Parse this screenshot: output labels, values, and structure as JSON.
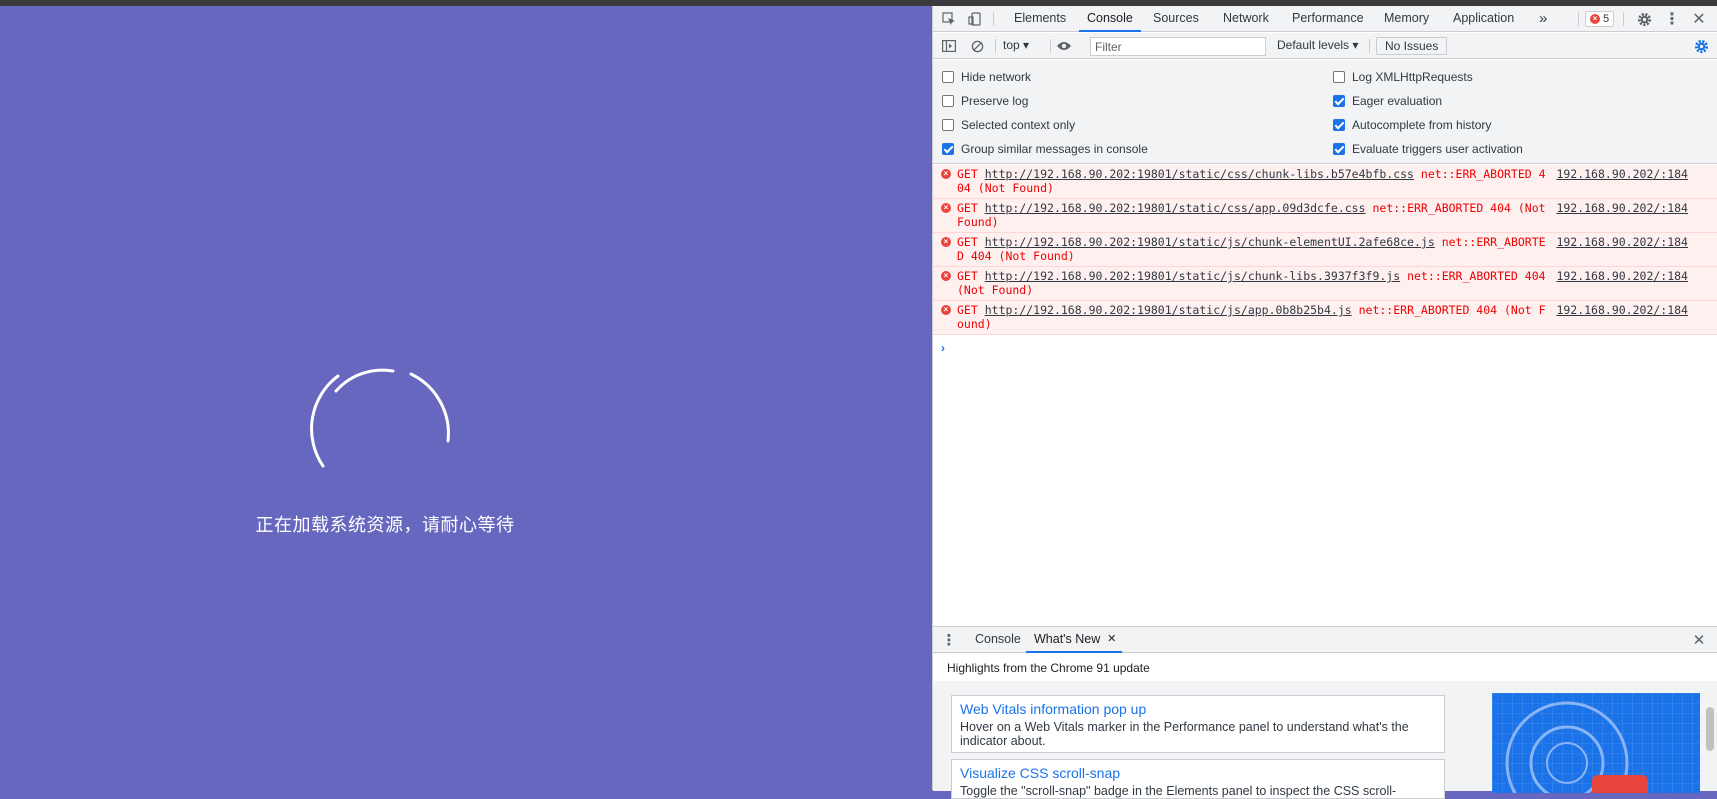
{
  "page": {
    "loading_text": "正在加载系统资源，请耐心等待"
  },
  "devtools": {
    "tabs": [
      "Elements",
      "Console",
      "Sources",
      "Network",
      "Performance",
      "Memory",
      "Application"
    ],
    "active_tab": "Console",
    "more_tabs": "»",
    "error_count": "5",
    "toolbar": {
      "context": "top ▾",
      "filter_placeholder": "Filter",
      "levels": "Default levels ▾",
      "issues": "No Issues"
    },
    "settings": {
      "left": [
        {
          "label": "Hide network",
          "checked": false
        },
        {
          "label": "Preserve log",
          "checked": false
        },
        {
          "label": "Selected context only",
          "checked": false
        },
        {
          "label": "Group similar messages in console",
          "checked": true
        }
      ],
      "right": [
        {
          "label": "Log XMLHttpRequests",
          "checked": false
        },
        {
          "label": "Eager evaluation",
          "checked": true
        },
        {
          "label": "Autocomplete from history",
          "checked": true
        },
        {
          "label": "Evaluate triggers user activation",
          "checked": true
        }
      ]
    },
    "messages": [
      {
        "method": "GET",
        "url": "http://192.168.90.202:19801/static/css/chunk-libs.b57e4bfb.css",
        "error": "net::ERR_ABORTED 404 (Not Found)",
        "source": "192.168.90.202/:184"
      },
      {
        "method": "GET",
        "url": "http://192.168.90.202:19801/static/css/app.09d3dcfe.css",
        "error": "net::ERR_ABORTED 404 (Not Found)",
        "source": "192.168.90.202/:184"
      },
      {
        "method": "GET",
        "url": "http://192.168.90.202:19801/static/js/chunk-elementUI.2afe68ce.js",
        "error": "net::ERR_ABORTED 404 (Not Found)",
        "source": "192.168.90.202/:184"
      },
      {
        "method": "GET",
        "url": "http://192.168.90.202:19801/static/js/chunk-libs.3937f3f9.js",
        "error": "net::ERR_ABORTED 404 (Not Found)",
        "source": "192.168.90.202/:184"
      },
      {
        "method": "GET",
        "url": "http://192.168.90.202:19801/static/js/app.0b8b25b4.js",
        "error": "net::ERR_ABORTED 404 (Not Found)",
        "source": "192.168.90.202/:184"
      }
    ],
    "prompt": "›",
    "drawer": {
      "tabs": [
        "Console",
        "What's New"
      ],
      "active_tab": "What's New",
      "highlights": "Highlights from the Chrome 91 update",
      "cards": [
        {
          "title": "Web Vitals information pop up",
          "desc": "Hover on a Web Vitals marker in the Performance panel to understand what's the indicator about."
        },
        {
          "title": "Visualize CSS scroll-snap",
          "desc": "Toggle the \"scroll-snap\" badge in the Elements panel to inspect the CSS scroll-"
        }
      ]
    }
  },
  "colors": {
    "page_bg": "#6767c0",
    "accent": "#1a73e8",
    "error_bg": "#fff0f0",
    "error_text": "#e00"
  }
}
